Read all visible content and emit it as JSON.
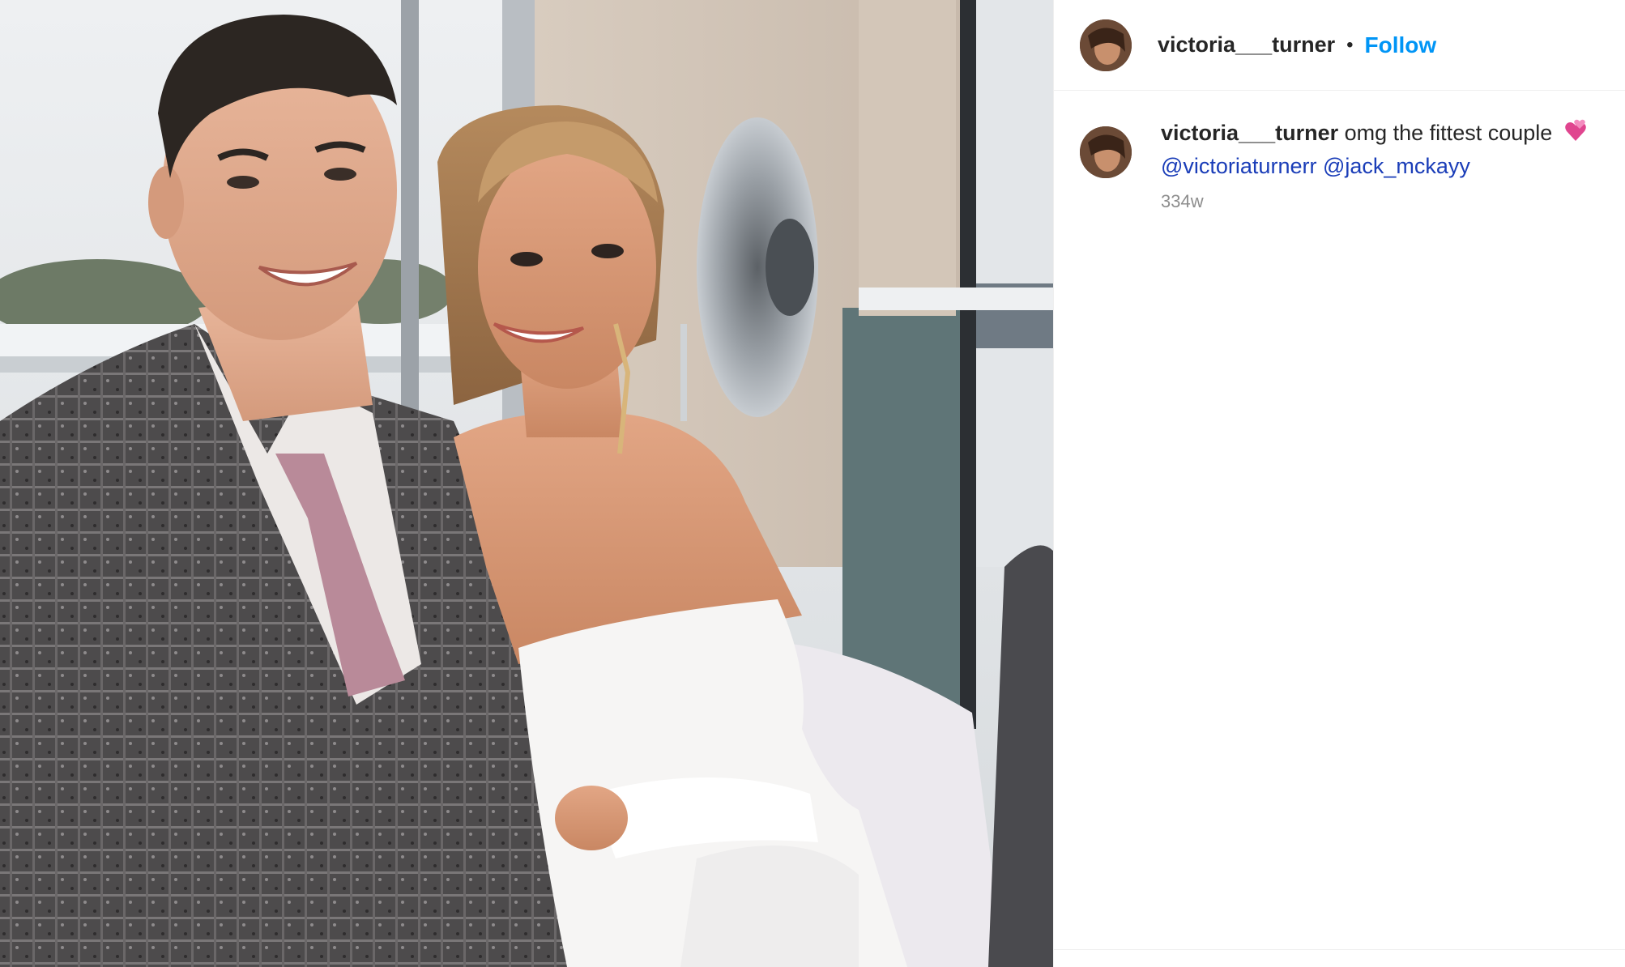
{
  "header": {
    "username": "victoria___turner",
    "separator": "•",
    "follow_label": "Follow"
  },
  "comment": {
    "username": "victoria___turner",
    "text": "omg the fittest couple",
    "emoji_icon": "revolving-hearts-icon",
    "mentions": [
      "@victoriaturnerr",
      "@jack_mckayy"
    ],
    "timestamp": "334w"
  },
  "colors": {
    "follow": "#0095f6",
    "mention": "#1a3db8",
    "text": "#262626",
    "muted": "#8e8e8e"
  }
}
